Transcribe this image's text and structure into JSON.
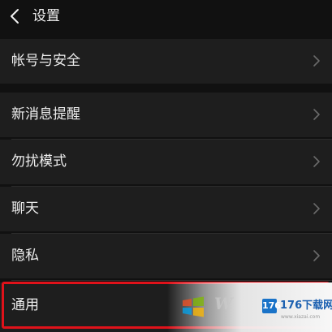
{
  "header": {
    "title": "设置",
    "back_icon": "chevron-left-icon"
  },
  "menu": {
    "items": [
      {
        "label": "帐号与安全",
        "icon": "chevron-right-icon"
      },
      {
        "label": "新消息提醒",
        "icon": "chevron-right-icon"
      },
      {
        "label": "勿扰模式",
        "icon": "chevron-right-icon"
      },
      {
        "label": "聊天",
        "icon": "chevron-right-icon"
      },
      {
        "label": "隐私",
        "icon": "chevron-right-icon"
      },
      {
        "label": "通用",
        "icon": "chevron-right-icon"
      }
    ]
  },
  "highlight": {
    "color": "#e0121a"
  },
  "watermark": {
    "logo": "windows-logo-icon",
    "text": "W",
    "badge": "176",
    "site": "176下载网",
    "sub": "www.xiazai.com"
  },
  "colors": {
    "background": "#111111",
    "row_background": "#1e1e1e",
    "text": "#ededed",
    "chevron": "#6a6a6a"
  }
}
